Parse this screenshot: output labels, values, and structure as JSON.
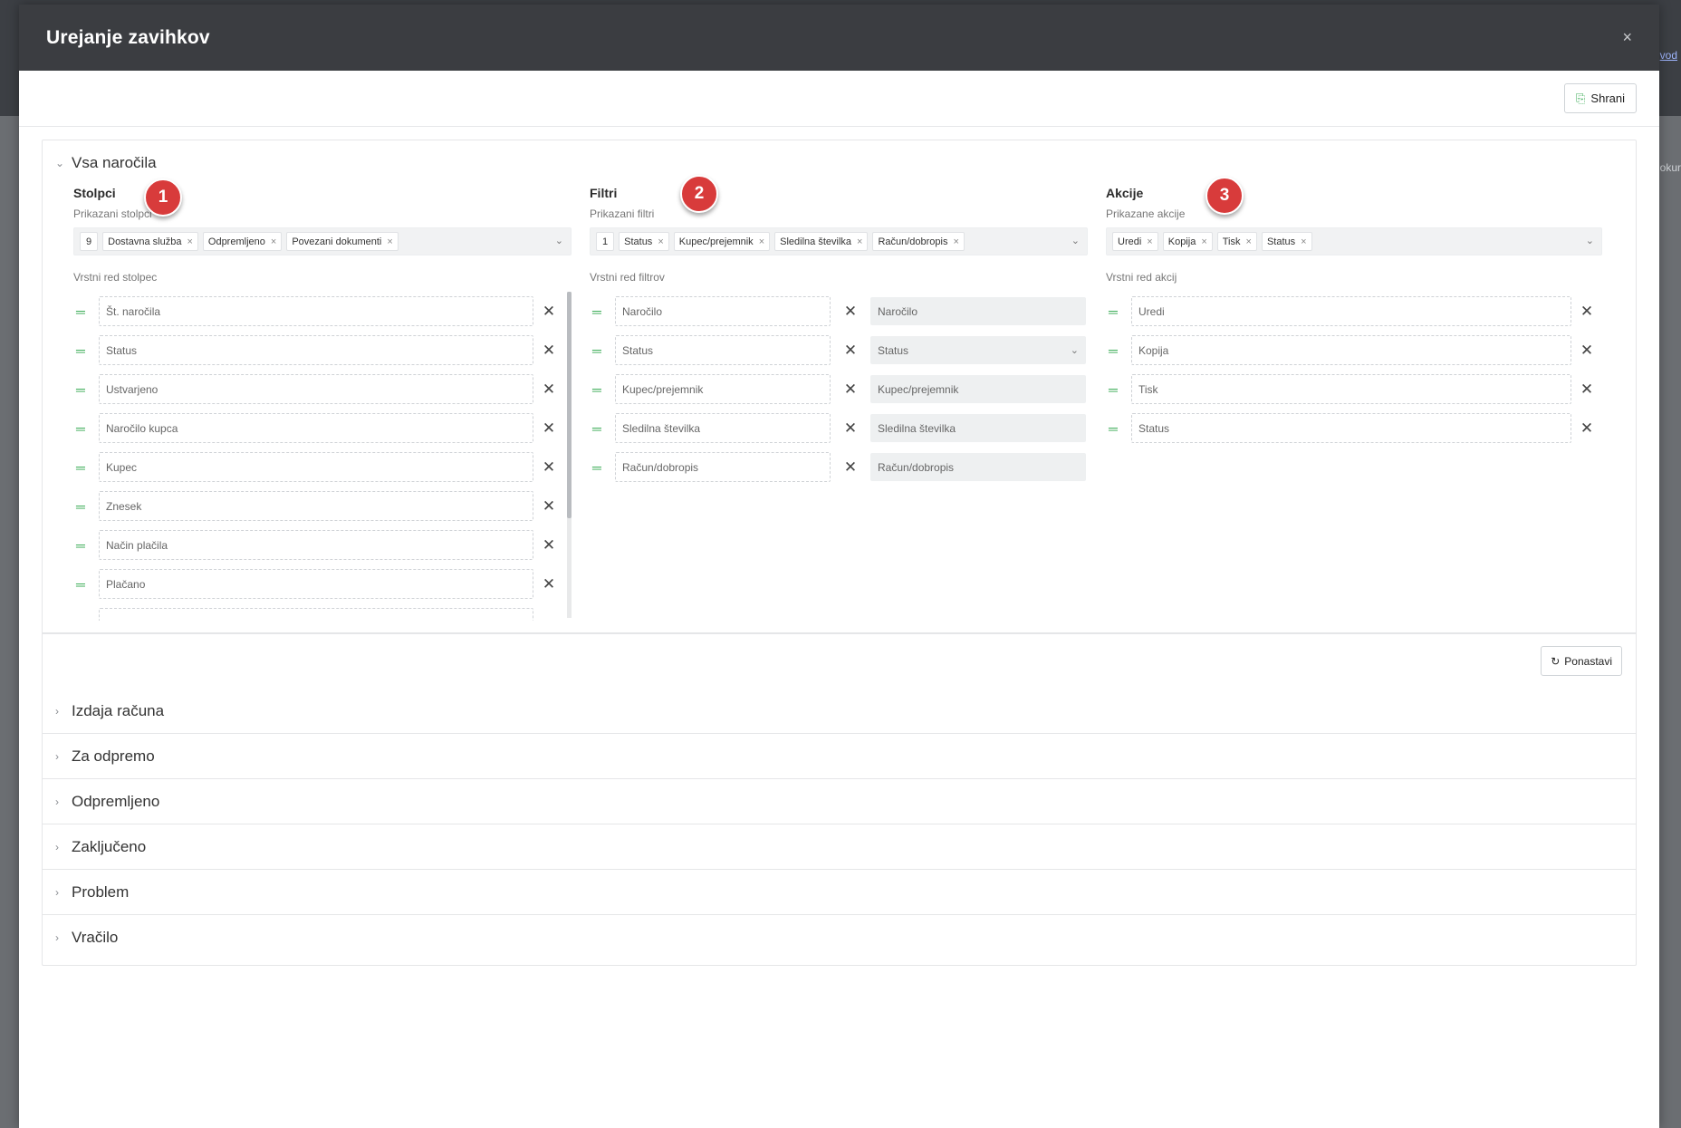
{
  "background": {
    "link_text": "vod",
    "col_text": "okur"
  },
  "modal": {
    "title": "Urejanje zavihkov",
    "close": "×"
  },
  "toolbar": {
    "save_label": "Shrani"
  },
  "sections": {
    "expanded_title": "Vsa naročila",
    "collapsed": [
      "Izdaja računa",
      "Za odpremo",
      "Odpremljeno",
      "Zaključeno",
      "Problem",
      "Vračilo"
    ]
  },
  "columns": {
    "title": "Stolpci",
    "shown_label": "Prikazani stolpci",
    "count": "9",
    "tags": [
      "Dostavna služba",
      "Odpremljeno",
      "Povezani dokumenti"
    ],
    "order_label": "Vrstni red stolpec",
    "items": [
      "Št. naročila",
      "Status",
      "Ustvarjeno",
      "Naročilo kupca",
      "Kupec",
      "Znesek",
      "Način plačila",
      "Plačano"
    ]
  },
  "filters": {
    "title": "Filtri",
    "shown_label": "Prikazani filtri",
    "count": "1",
    "tags": [
      "Status",
      "Kupec/prejemnik",
      "Sledilna številka",
      "Račun/dobropis"
    ],
    "order_label": "Vrstni red filtrov",
    "items": [
      "Naročilo",
      "Status",
      "Kupec/prejemnik",
      "Sledilna številka",
      "Račun/dobropis"
    ],
    "values": [
      "Naročilo",
      "Status",
      "Kupec/prejemnik",
      "Sledilna številka",
      "Račun/dobropis"
    ]
  },
  "actions": {
    "title": "Akcije",
    "shown_label": "Prikazane akcije",
    "tags": [
      "Uredi",
      "Kopija",
      "Tisk",
      "Status"
    ],
    "order_label": "Vrstni red akcij",
    "items": [
      "Uredi",
      "Kopija",
      "Tisk",
      "Status"
    ]
  },
  "badges": [
    "1",
    "2",
    "3"
  ],
  "reset_label": "Ponastavi",
  "colors": {
    "accent_green": "#3fae5a",
    "badge_red": "#d83b3b",
    "header_dark": "#3b3d41"
  }
}
